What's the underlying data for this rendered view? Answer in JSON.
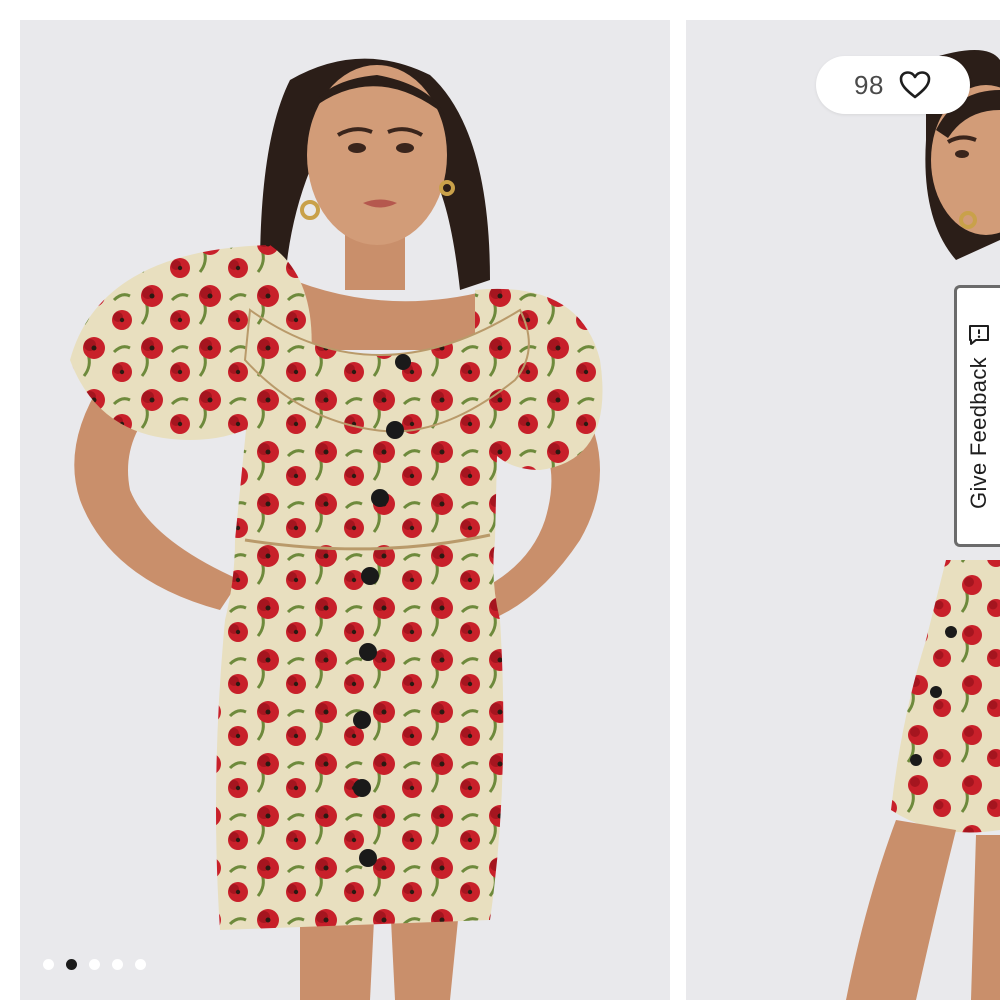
{
  "product_gallery": {
    "slides": [
      {
        "alt": "Model wearing red poppy print puff-sleeve mini dress"
      },
      {
        "alt": "Model wearing red poppy print mini dress, alternate view"
      }
    ],
    "pagination": {
      "total": 5,
      "active_index": 1
    }
  },
  "favorites": {
    "count": "98",
    "icon": "heart-outline-icon"
  },
  "feedback_tab": {
    "label": "Give Feedback",
    "icon": "message-square-icon"
  },
  "colors": {
    "slide_background": "#e9e9ec",
    "dress_base": "#e8dfbf",
    "poppy_red": "#c8202a",
    "leaf_green": "#6e8a3c",
    "button_black": "#1a1a1a",
    "active_dot": "#1b1b1b"
  }
}
